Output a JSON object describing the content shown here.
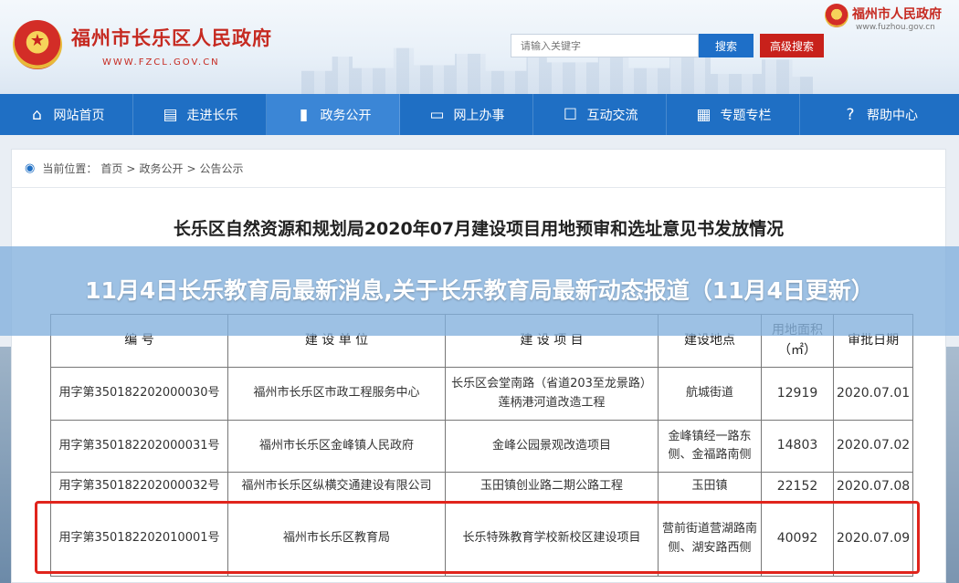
{
  "header": {
    "site_name": "福州市长乐区人民政府",
    "site_url": "WWW.FZCL.GOV.CN",
    "search_placeholder": "请输入关键字",
    "search_button": "搜索",
    "advanced_search_button": "高级搜索",
    "top_right_name": "福州市人民政府",
    "top_right_url": "www.fuzhou.gov.cn"
  },
  "nav": [
    {
      "label": "网站首页",
      "icon": "home-icon"
    },
    {
      "label": "走进长乐",
      "icon": "document-icon"
    },
    {
      "label": "政务公开",
      "icon": "bookmark-icon",
      "active": true
    },
    {
      "label": "网上办事",
      "icon": "monitor-icon"
    },
    {
      "label": "互动交流",
      "icon": "chat-icon"
    },
    {
      "label": "专题专栏",
      "icon": "grid-icon"
    },
    {
      "label": "帮助中心",
      "icon": "help-icon"
    }
  ],
  "breadcrumb": {
    "prefix": "当前位置：",
    "items": [
      "首页",
      "政务公开",
      "公告公示"
    ],
    "separator": ">"
  },
  "article_title": "长乐区自然资源和规划局2020年07月建设项目用地预审和选址意见书发放情况",
  "banner_title": "11月4日长乐教育局最新消息,关于长乐教育局最新动态报道（11月4日更新）",
  "table": {
    "headers": [
      "编 号",
      "建 设 单 位",
      "建 设 项 目",
      "建设地点",
      "用地面积",
      "（㎡）",
      "审批日期"
    ],
    "rows": [
      [
        "用字第350182202000030号",
        "福州市长乐区市政工程服务中心",
        "长乐区会堂南路（省道203至龙景路）莲柄港河道改造工程",
        "航城街道",
        "12919",
        "2020.07.01"
      ],
      [
        "用字第350182202000031号",
        "福州市长乐区金峰镇人民政府",
        "金峰公园景观改造项目",
        "金峰镇经一路东侧、金福路南侧",
        "14803",
        "2020.07.02"
      ],
      [
        "用字第350182202000032号",
        "福州市长乐区纵横交通建设有限公司",
        "玉田镇创业路二期公路工程",
        "玉田镇",
        "22152",
        "2020.07.08"
      ],
      [
        "用字第350182202010001号",
        "福州市长乐区教育局",
        "长乐特殊教育学校新校区建设项目",
        "营前街道营湖路南侧、湖安路西侧",
        "40092",
        "2020.07.09"
      ]
    ]
  },
  "colors": {
    "nav_bg": "#1f6fc4",
    "brand_red": "#c62a21",
    "highlight_border": "#e0241c",
    "banner_bg": "#82afdc"
  }
}
